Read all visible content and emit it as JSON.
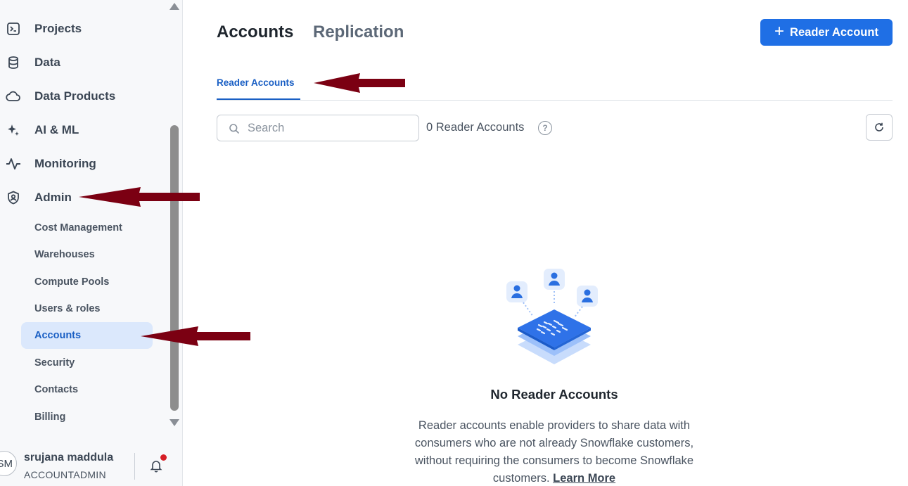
{
  "sidebar": {
    "nav_items": [
      {
        "label": "Projects",
        "icon": "terminal-icon"
      },
      {
        "label": "Data",
        "icon": "database-icon"
      },
      {
        "label": "Data Products",
        "icon": "cloud-icon"
      },
      {
        "label": "AI & ML",
        "icon": "sparkle-icon"
      },
      {
        "label": "Monitoring",
        "icon": "activity-icon"
      },
      {
        "label": "Admin",
        "icon": "shield-user-icon"
      }
    ],
    "admin_items": [
      {
        "label": "Cost Management"
      },
      {
        "label": "Warehouses"
      },
      {
        "label": "Compute Pools"
      },
      {
        "label": "Users & roles"
      },
      {
        "label": "Accounts",
        "active": true
      },
      {
        "label": "Security"
      },
      {
        "label": "Contacts"
      },
      {
        "label": "Billing"
      }
    ],
    "user": {
      "initials": "SM",
      "name": "srujana maddula",
      "role": "ACCOUNTADMIN",
      "has_notification": true
    }
  },
  "header": {
    "tabs": [
      {
        "label": "Accounts",
        "active": true
      },
      {
        "label": "Replication",
        "active": false
      }
    ],
    "primary_button": "Reader Account"
  },
  "subtabs": [
    {
      "label": "Reader Accounts",
      "active": true
    }
  ],
  "toolbar": {
    "search_placeholder": "Search",
    "search_value": "",
    "count_label": "0 Reader Accounts",
    "help_icon": "?"
  },
  "empty_state": {
    "title": "No Reader Accounts",
    "description": "Reader accounts enable providers to share data with consumers who are not already Snowflake customers, without requiring the consumers to become Snowflake customers.",
    "link": "Learn More"
  },
  "colors": {
    "accent": "#1f6fe5",
    "active_bg": "#dbe8fc",
    "annotation_arrow": "#7b0012",
    "notification_dot": "#d61f26"
  }
}
